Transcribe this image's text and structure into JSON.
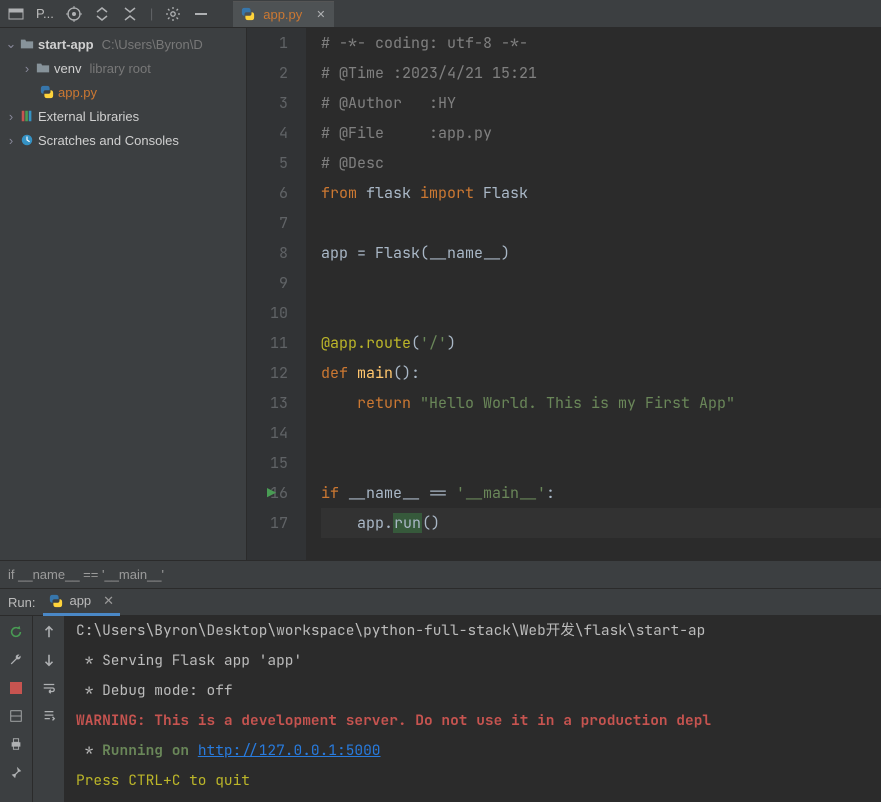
{
  "toolbar": {
    "project_label": "P...",
    "tab_file": "app.py"
  },
  "tree": {
    "root_name": "start-app",
    "root_path": "C:\\Users\\Byron\\D",
    "venv": "venv",
    "venv_hint": "library root",
    "file": "app.py",
    "ext_lib": "External Libraries",
    "scratches": "Scratches and Consoles"
  },
  "code": {
    "lines": [
      {
        "n": 1,
        "seg": [
          {
            "t": "# -*- coding: utf-8 -*-",
            "c": "c-comment"
          }
        ]
      },
      {
        "n": 2,
        "seg": [
          {
            "t": "# @Time :2023/4/21 15:21",
            "c": "c-comment"
          }
        ]
      },
      {
        "n": 3,
        "seg": [
          {
            "t": "# @Author   :HY",
            "c": "c-comment"
          }
        ]
      },
      {
        "n": 4,
        "seg": [
          {
            "t": "# @File     :app.py",
            "c": "c-comment"
          }
        ]
      },
      {
        "n": 5,
        "seg": [
          {
            "t": "# @Desc",
            "c": "c-comment"
          }
        ]
      },
      {
        "n": 6,
        "seg": [
          {
            "t": "from ",
            "c": "c-kw"
          },
          {
            "t": "flask ",
            "c": "c-name"
          },
          {
            "t": "import ",
            "c": "c-kw"
          },
          {
            "t": "Flask",
            "c": "c-name"
          }
        ]
      },
      {
        "n": 7,
        "seg": [
          {
            "t": "",
            "c": ""
          }
        ]
      },
      {
        "n": 8,
        "seg": [
          {
            "t": "app = Flask(",
            "c": "c-name"
          },
          {
            "t": "__name__",
            "c": "c-name"
          },
          {
            "t": ")",
            "c": "c-name"
          }
        ]
      },
      {
        "n": 9,
        "seg": [
          {
            "t": "",
            "c": ""
          }
        ]
      },
      {
        "n": 10,
        "seg": [
          {
            "t": "",
            "c": ""
          }
        ]
      },
      {
        "n": 11,
        "seg": [
          {
            "t": "@app.route",
            "c": "c-dec"
          },
          {
            "t": "(",
            "c": "c-name"
          },
          {
            "t": "'/'",
            "c": "c-str"
          },
          {
            "t": ")",
            "c": "c-name"
          }
        ]
      },
      {
        "n": 12,
        "seg": [
          {
            "t": "def ",
            "c": "c-kw"
          },
          {
            "t": "main",
            "c": "c-fn"
          },
          {
            "t": "():",
            "c": "c-name"
          }
        ]
      },
      {
        "n": 13,
        "seg": [
          {
            "t": "    ",
            "c": ""
          },
          {
            "t": "return ",
            "c": "c-kw"
          },
          {
            "t": "\"Hello World. This is my First App\"",
            "c": "c-str"
          }
        ]
      },
      {
        "n": 14,
        "seg": [
          {
            "t": "",
            "c": ""
          }
        ]
      },
      {
        "n": 15,
        "seg": [
          {
            "t": "",
            "c": ""
          }
        ]
      },
      {
        "n": 16,
        "seg": [
          {
            "t": "if ",
            "c": "c-kw"
          },
          {
            "t": "__name__ == ",
            "c": "c-name"
          },
          {
            "t": "'__main__'",
            "c": "c-str"
          },
          {
            "t": ":",
            "c": "c-name"
          }
        ],
        "play": true
      },
      {
        "n": 17,
        "seg": [
          {
            "t": "    app.",
            "c": "c-name"
          },
          {
            "t": "run",
            "c": "c-run"
          },
          {
            "t": "()",
            "c": "c-name"
          }
        ],
        "hl": true
      }
    ]
  },
  "crumb": "if __name__ == '__main__'",
  "run": {
    "label": "Run:",
    "tab": "app",
    "lines": [
      {
        "t": "C:\\Users\\Byron\\Desktop\\workspace\\python-full-stack\\Web开发\\flask\\start-ap",
        "c": "co-white"
      },
      {
        "t": " * Serving Flask app 'app'",
        "c": "co-white"
      },
      {
        "t": " * Debug mode: off",
        "c": "co-white"
      },
      {
        "t": "WARNING: This is a development server. Do not use it in a production depl",
        "c": "co-warn"
      },
      {
        "pre": " * ",
        "green": "Running on ",
        "link": "http://127.0.0.1:5000"
      },
      {
        "t": "Press CTRL+C to quit",
        "c": "co-yellow"
      }
    ]
  }
}
